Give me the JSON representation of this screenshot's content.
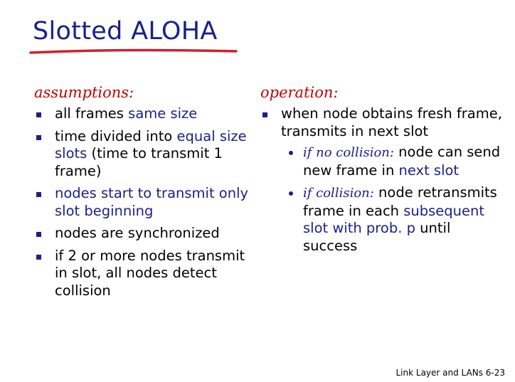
{
  "title": "Slotted ALOHA",
  "colors": {
    "title": "#1a1f8c",
    "underline": "#d11f2e",
    "heading": "#c00000",
    "highlight": "#1a1f8c"
  },
  "assumptions": {
    "heading": "assumptions:",
    "items": [
      {
        "a": "all frames ",
        "b": "same size"
      },
      {
        "a": "time divided into ",
        "b": "equal size slots",
        "c": " (time to transmit 1 frame)"
      },
      {
        "b": "nodes start to transmit only slot beginning"
      },
      {
        "a": "nodes are synchronized"
      },
      {
        "a": "if 2 or more nodes transmit in slot, all nodes detect collision"
      }
    ]
  },
  "operation": {
    "heading": "operation:",
    "main": "when node obtains fresh frame, transmits in next slot",
    "sub": [
      {
        "if": "if ",
        "cond": "no collision:",
        "t1": " node can send new frame in ",
        "hl": "next slot",
        "t2": ""
      },
      {
        "if": "if ",
        "cond": "collision:",
        "t1": " node retransmits frame in each ",
        "hl": "subsequent slot with prob. p",
        "t2": " until success"
      }
    ]
  },
  "footer": "Link Layer and LANs  6-23"
}
